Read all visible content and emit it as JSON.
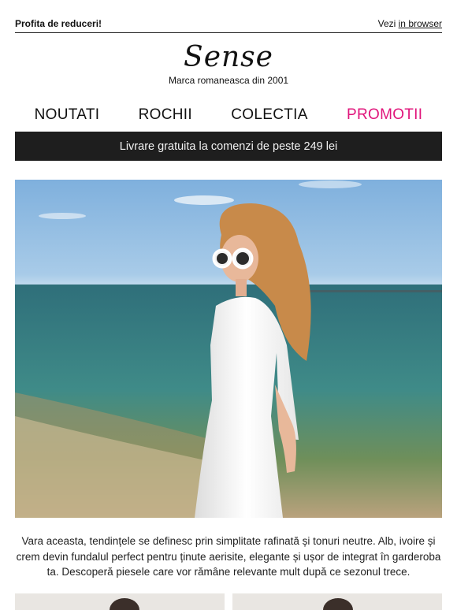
{
  "topbar": {
    "left_text": "Profita de reduceri!",
    "view_prefix": "Vezi",
    "view_link": "in browser"
  },
  "brand": {
    "logo": "Sense",
    "tagline": "Marca romaneasca din 2001"
  },
  "nav": {
    "items": [
      "NOUTATI",
      "ROCHII",
      "COLECTIA",
      "PROMOTII"
    ],
    "promo_color": "#e0157b"
  },
  "banner": {
    "text": "Livrare gratuita la comenzi de peste 249 lei"
  },
  "intro": {
    "text": "Vara aceasta, tendințele se definesc prin simplitate rafinată și tonuri neutre. Alb, ivoire și crem devin fundalul perfect pentru ținute aerisite, elegante și ușor de integrat în garderoba ta. Descoperă piesele care vor rămâne relevante mult după ce sezonul trece."
  },
  "colors": {
    "banner_bg": "#1e1e1e",
    "accent": "#e0157b"
  }
}
